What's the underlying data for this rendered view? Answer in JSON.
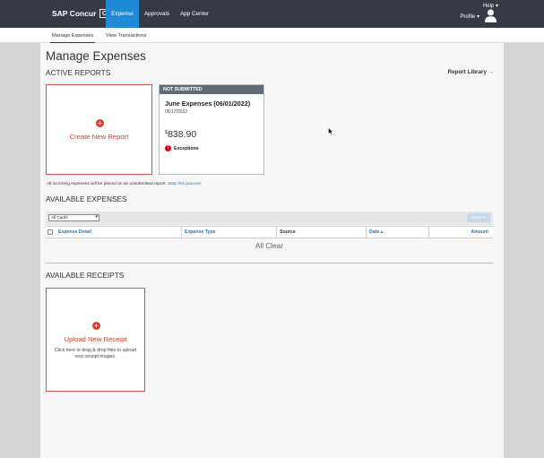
{
  "topbar": {
    "brand": "SAP Concur",
    "brand_logo": "C",
    "tabs": [
      {
        "label": "Expense",
        "active": true
      },
      {
        "label": "Approvals",
        "active": false
      },
      {
        "label": "App Center",
        "active": false
      }
    ],
    "help": "Help ▾",
    "profile": "Profile ▾",
    "avatar_icon": "user-avatar-icon"
  },
  "subnav": {
    "items": [
      {
        "label": "Manage Expenses",
        "active": true
      },
      {
        "label": "View Transactions",
        "active": false
      }
    ]
  },
  "page": {
    "title": "Manage Expenses",
    "report_library": "Report Library",
    "report_library_arrow": "→"
  },
  "active_reports": {
    "title": "ACTIVE REPORTS",
    "create_label": "Create New Report",
    "plus_icon": "+",
    "report": {
      "status": "NOT SUBMITTED",
      "name": "June Expenses (06/01/2022)",
      "date": "06/17/2022",
      "currency": "$",
      "amount": "838.90",
      "exception_icon": "!",
      "exceptions": "Exceptions"
    },
    "incoming_text": "All incoming expenses will be placed on an unsubmitted report.",
    "incoming_link": "Stop this process."
  },
  "available_expenses": {
    "title": "AVAILABLE EXPENSES",
    "card_filter": "All Cards",
    "move_button": "Move ▾",
    "columns": {
      "detail": "Expense Detail",
      "type": "Expense Type",
      "source": "Source",
      "date": "Date ▴",
      "amount": "Amount"
    },
    "empty_text": "All Clear"
  },
  "available_receipts": {
    "title": "AVAILABLE RECEIPTS",
    "upload_label": "Upload New Receipt",
    "upload_desc": "Click here or drag & drop files to upload new receipt images.",
    "plus_icon": "+"
  },
  "colors": {
    "topbar": "#353a45",
    "active_tab": "#1f8ad6",
    "accent_red": "#c44533",
    "link_blue": "#1f75c4",
    "status_header": "#5f6c78"
  }
}
